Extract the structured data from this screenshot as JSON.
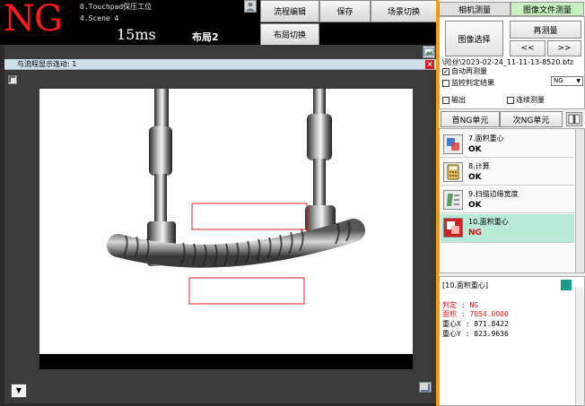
{
  "status": {
    "result": "NG",
    "scene_line1": "0.Touchpad保压工位",
    "scene_line2": "4.Scene 4",
    "time": "15ms",
    "layout": "布局2"
  },
  "toolbar": {
    "flow_edit": "流程编辑",
    "save": "保存",
    "scene_switch": "场景切换",
    "layout_switch": "布局切换"
  },
  "image_window": {
    "title": "与流程显示连动: 1",
    "close": "×",
    "down": "▼"
  },
  "right_panel": {
    "tabs": [
      "相机测量",
      "图像文件测量"
    ],
    "image_select": "图像选择",
    "remeasure": "再测量",
    "prev": "<<",
    "next": ">>",
    "file_path": "\\险丝\\2023-02-24_11-11-13-8520.bfz",
    "auto_remeasure": "自动再测量",
    "auto_remeasure_checked": true,
    "monitor_result": "监控判定结果",
    "monitor_result_checked": false,
    "ng_option": "NG",
    "output": "输出",
    "continuous": "连续测量",
    "first_ng": "首NG单元",
    "next_ng": "次NG单元"
  },
  "units": [
    {
      "name": "7.面积重心",
      "result": "OK",
      "icon": "area-centroid-icon",
      "status": "ok"
    },
    {
      "name": "8.计算",
      "result": "OK",
      "icon": "calculator-icon",
      "status": "ok"
    },
    {
      "name": "9.扫描边缘宽度",
      "result": "OK",
      "icon": "edge-width-icon",
      "status": "ok"
    },
    {
      "name": "10.面积重心",
      "result": "NG",
      "icon": "area-centroid-icon",
      "status": "ng"
    }
  ],
  "detail": {
    "header": "[10.面积重心]",
    "judge": "判定 : NG",
    "area": "面积 : 7054.0000",
    "cx": "重心X : 871.8422",
    "cy": "重心Y : 823.9636"
  },
  "colors": {
    "ng_red": "#ff1a1a",
    "accent_orange": "#f39c12",
    "ng_row": "#b9ead8",
    "roi_red": "#e02020"
  }
}
